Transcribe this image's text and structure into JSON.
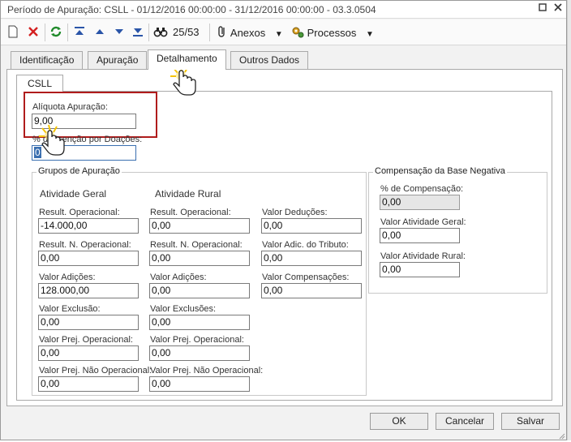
{
  "window": {
    "title": "Período de Apuração: CSLL - 01/12/2016 00:00:00 - 31/12/2016 00:00:00 - 03.3.0504"
  },
  "toolbar": {
    "record_counter": "25/53",
    "anexos_label": "Anexos",
    "processos_label": "Processos"
  },
  "tabs": [
    {
      "label": "Identificação"
    },
    {
      "label": "Apuração"
    },
    {
      "label": "Detalhamento"
    },
    {
      "label": "Outros Dados"
    }
  ],
  "subtab": {
    "label": "CSLL"
  },
  "fields": {
    "aliquota_label": "Alíquota Apuração:",
    "aliquota_value": "9,00",
    "doacoes_label": "% de Isenção por Doações:",
    "doacoes_value": "0"
  },
  "grupos": {
    "title": "Grupos de Apuração",
    "geral_title": "Atividade Geral",
    "rural_title": "Atividade Rural",
    "geral": [
      {
        "label": "Result. Operacional:",
        "value": "-14.000,00"
      },
      {
        "label": "Result. N. Operacional:",
        "value": "0,00"
      },
      {
        "label": "Valor Adições:",
        "value": "128.000,00"
      },
      {
        "label": "Valor Exclusão:",
        "value": "0,00"
      },
      {
        "label": "Valor Prej. Operacional:",
        "value": "0,00"
      },
      {
        "label": "Valor Prej. Não Operacional:",
        "value": "0,00"
      }
    ],
    "rural": [
      {
        "label": "Result. Operacional:",
        "value": "0,00"
      },
      {
        "label": "Result. N. Operacional:",
        "value": "0,00"
      },
      {
        "label": "Valor Adições:",
        "value": "0,00"
      },
      {
        "label": "Valor Exclusões:",
        "value": "0,00"
      },
      {
        "label": "Valor Prej. Operacional:",
        "value": "0,00"
      },
      {
        "label": "Valor Prej. Não Operacional:",
        "value": "0,00"
      }
    ],
    "outros": [
      {
        "label": "Valor Deduções:",
        "value": "0,00"
      },
      {
        "label": "Valor Adic. do Tributo:",
        "value": "0,00"
      },
      {
        "label": "Valor Compensações:",
        "value": "0,00"
      }
    ]
  },
  "compensacao": {
    "title": "Compensação da Base Negativa",
    "items": [
      {
        "label": "% de Compensação:",
        "value": "0,00"
      },
      {
        "label": "Valor Atividade Geral:",
        "value": "0,00"
      },
      {
        "label": "Valor Atividade Rural:",
        "value": "0,00"
      }
    ]
  },
  "buttons": {
    "ok": "OK",
    "cancel": "Cancelar",
    "save": "Salvar"
  },
  "colors": {
    "highlight_border": "#b01c1c",
    "cursor_glow": "#f5c400"
  }
}
